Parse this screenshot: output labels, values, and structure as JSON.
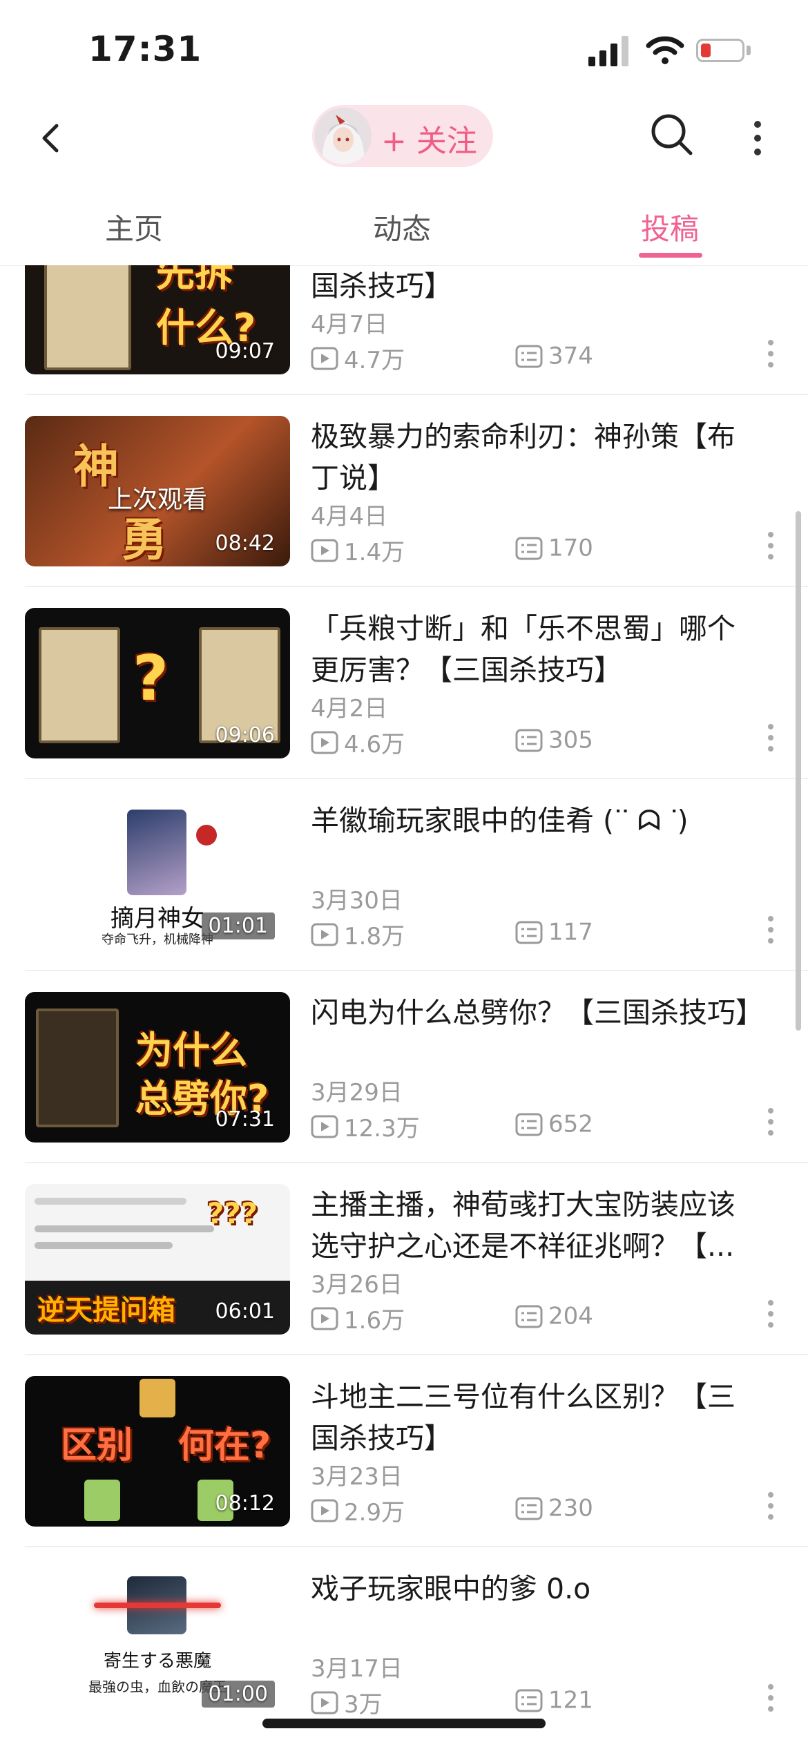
{
  "status_bar": {
    "time": "17:31"
  },
  "navbar": {
    "follow_label": "+ 关注"
  },
  "tabs": [
    {
      "label": "主页",
      "active": false
    },
    {
      "label": "动态",
      "active": false
    },
    {
      "label": "投稿",
      "active": true
    }
  ],
  "accent_color": "#f06292",
  "videos": [
    {
      "title": "「过河拆桥」应该先拆什么？【三国杀技巧】",
      "date": "4月7日",
      "views": "4.7万",
      "comments": "374",
      "duration": "09:07",
      "thumb_text": [
        "先拆",
        "什么?"
      ]
    },
    {
      "title": "极致暴力的索命利刃：神孙策【布丁说】",
      "date": "4月4日",
      "views": "1.4万",
      "comments": "170",
      "duration": "08:42",
      "thumb_text": [
        "神",
        "勇"
      ],
      "overlay": "上次观看"
    },
    {
      "title": "「兵粮寸断」和「乐不思蜀」哪个更厉害？【三国杀技巧】",
      "date": "4月2日",
      "views": "4.6万",
      "comments": "305",
      "duration": "09:06",
      "thumb_text": [
        "?"
      ]
    },
    {
      "title": "羊徽瑜玩家眼中的佳肴 (ᐝᐝ ᗣ ᐝ)",
      "date": "3月30日",
      "views": "1.8万",
      "comments": "117",
      "duration": "01:01",
      "thumb_text": [
        "摘月神女",
        "夺命飞升，机械降神"
      ]
    },
    {
      "title": "闪电为什么总劈你？【三国杀技巧】",
      "date": "3月29日",
      "views": "12.3万",
      "comments": "652",
      "duration": "07:31",
      "thumb_text": [
        "为什么",
        "总劈你?"
      ]
    },
    {
      "title": "主播主播，神荀彧打大宝防装应该选守护之心还是不祥征兆啊？【...",
      "date": "3月26日",
      "views": "1.6万",
      "comments": "204",
      "duration": "06:01",
      "thumb_text": [
        "逆天提问箱",
        "???"
      ]
    },
    {
      "title": "斗地主二三号位有什么区别？【三国杀技巧】",
      "date": "3月23日",
      "views": "2.9万",
      "comments": "230",
      "duration": "08:12",
      "thumb_text": [
        "区别",
        "何在?"
      ]
    },
    {
      "title": "戏子玩家眼中的爹 0.o",
      "date": "3月17日",
      "views": "3万",
      "comments": "121",
      "duration": "01:00",
      "thumb_text": [
        "寄生する悪魔",
        "最強の虫，血飲の魔王"
      ]
    }
  ]
}
